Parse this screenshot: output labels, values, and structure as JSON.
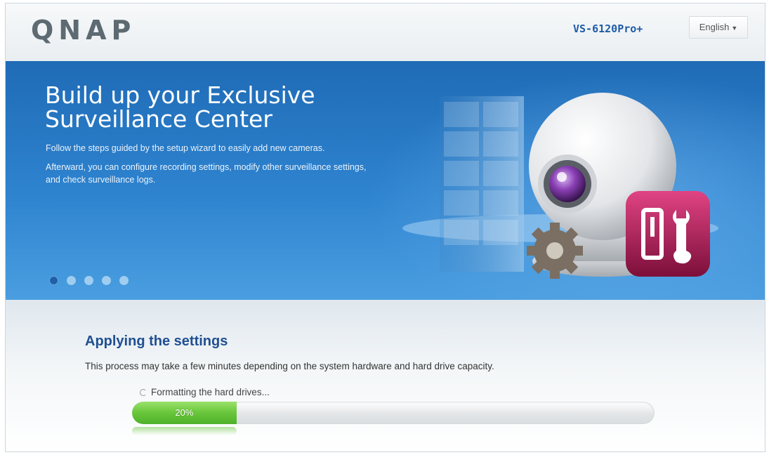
{
  "header": {
    "logo": "QNAP",
    "model": "VS-6120Pro+",
    "language": "English"
  },
  "banner": {
    "title_line1": "Build up your Exclusive",
    "title_line2": "Surveillance Center",
    "description1": "Follow the steps guided by the setup wizard to easily add new cameras.",
    "description2": "Afterward, you can configure recording settings, modify other surveillance settings, and check surveillance logs.",
    "slides": 5,
    "active_slide": 1
  },
  "apply": {
    "title": "Applying the settings",
    "description": "This process may take a few minutes depending on the system hardware and hard drive capacity.",
    "status_text": "Formatting the hard drives...",
    "progress_percent": 20,
    "progress_label": "20%"
  },
  "colors": {
    "brand_blue": "#1f5ca8",
    "banner_blue": "#2e83cf",
    "progress_green": "#6cc83d",
    "tool_icon_magenta": "#b0174f"
  },
  "icons": [
    "spinner-icon",
    "webcam-icon",
    "gear-icon",
    "settings-tool-icon",
    "chevron-down-icon"
  ]
}
